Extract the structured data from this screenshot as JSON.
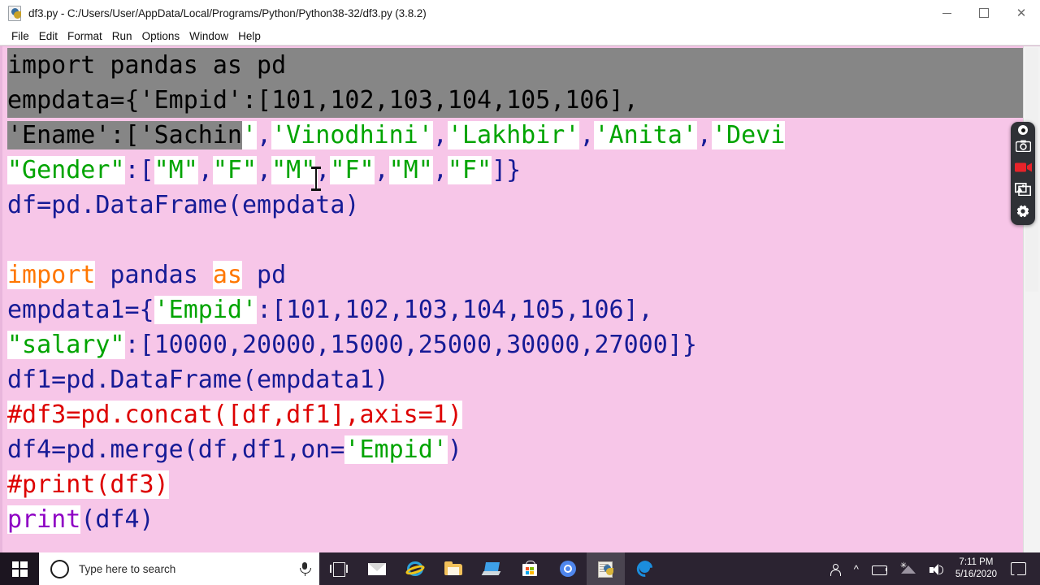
{
  "window": {
    "title": "df3.py - C:/Users/User/AppData/Local/Programs/Python/Python38-32/df3.py (3.8.2)",
    "icon": "python-file-icon",
    "minimize_label": "—",
    "maximize_label": "□",
    "close_label": "✕"
  },
  "menubar": {
    "items": [
      {
        "label": "File"
      },
      {
        "label": "Edit"
      },
      {
        "label": "Format"
      },
      {
        "label": "Run"
      },
      {
        "label": "Options"
      },
      {
        "label": "Window"
      },
      {
        "label": "Help"
      }
    ]
  },
  "editor": {
    "lines": [
      {
        "segments": [
          {
            "text": "import pandas as pd",
            "style": "sel"
          }
        ]
      },
      {
        "segments": [
          {
            "text": "empdata={'Empid':[101,102,103,104,105,106],",
            "style": "sel"
          }
        ]
      },
      {
        "segments": [
          {
            "text": "'Ename':['Sachin",
            "style": "sel"
          },
          {
            "text": "'",
            "style": "str-white"
          },
          {
            "text": ",",
            "style": "code"
          },
          {
            "text": "'Vinodhini'",
            "style": "str-white"
          },
          {
            "text": ",",
            "style": "code"
          },
          {
            "text": "'Lakhbir'",
            "style": "str-white"
          },
          {
            "text": ",",
            "style": "code"
          },
          {
            "text": "'Anita'",
            "style": "str-white"
          },
          {
            "text": ",",
            "style": "code"
          },
          {
            "text": "'Devi",
            "style": "str-white"
          }
        ]
      },
      {
        "segments": [
          {
            "text": "\"Gender\"",
            "style": "str-white"
          },
          {
            "text": ":[",
            "style": "code"
          },
          {
            "text": "\"M\"",
            "style": "str-white"
          },
          {
            "text": ",",
            "style": "code"
          },
          {
            "text": "\"F\"",
            "style": "str-white"
          },
          {
            "text": ",",
            "style": "code"
          },
          {
            "text": "\"M\"",
            "style": "str-white"
          },
          {
            "text": ",",
            "style": "code"
          },
          {
            "text": "\"F\"",
            "style": "str-white"
          },
          {
            "text": ",",
            "style": "code"
          },
          {
            "text": "\"M\"",
            "style": "str-white"
          },
          {
            "text": ",",
            "style": "code"
          },
          {
            "text": "\"F\"",
            "style": "str-white"
          },
          {
            "text": "]}",
            "style": "code"
          }
        ]
      },
      {
        "segments": [
          {
            "text": "df=pd.DataFrame(empdata)",
            "style": "code"
          }
        ]
      },
      {
        "segments": [
          {
            "text": "",
            "style": "code"
          }
        ]
      },
      {
        "segments": [
          {
            "text": "import",
            "style": "kw-white"
          },
          {
            "text": " pandas ",
            "style": "code"
          },
          {
            "text": "as",
            "style": "kw-white"
          },
          {
            "text": " pd",
            "style": "code"
          }
        ]
      },
      {
        "segments": [
          {
            "text": "empdata1={",
            "style": "code"
          },
          {
            "text": "'Empid'",
            "style": "str-white"
          },
          {
            "text": ":[101,102,103,104,105,106],",
            "style": "code"
          }
        ]
      },
      {
        "segments": [
          {
            "text": "\"salary\"",
            "style": "str-white"
          },
          {
            "text": ":[10000,20000,15000,25000,30000,27000]}",
            "style": "code"
          }
        ]
      },
      {
        "segments": [
          {
            "text": "df1=pd.DataFrame(empdata1)",
            "style": "code"
          }
        ]
      },
      {
        "segments": [
          {
            "text": "#df3=pd.concat([df,df1],axis=1)",
            "style": "comment-white"
          }
        ]
      },
      {
        "segments": [
          {
            "text": "df4=pd.merge(df,df1,on=",
            "style": "code"
          },
          {
            "text": "'Empid'",
            "style": "str-white"
          },
          {
            "text": ")",
            "style": "code"
          }
        ]
      },
      {
        "segments": [
          {
            "text": "#print(df3)",
            "style": "comment-white"
          }
        ]
      },
      {
        "segments": [
          {
            "text": "print",
            "style": "builtin"
          },
          {
            "text": "(df4)",
            "style": "code"
          }
        ]
      }
    ],
    "colors": {
      "background": "#f7c6e8",
      "selection": "#868686",
      "string": "#00a400",
      "keyword": "#ff7700",
      "builtin": "#8e00c4",
      "comment": "#dd0000",
      "code": "#161b96"
    },
    "cursor": "i-beam-text-cursor"
  },
  "recorder_toolbar": {
    "buttons": [
      {
        "name": "record-indicator",
        "icon": "record-dot-icon"
      },
      {
        "name": "screenshot",
        "icon": "camera-icon"
      },
      {
        "name": "record-video",
        "icon": "video-camera-icon"
      },
      {
        "name": "gallery",
        "icon": "image-icon"
      },
      {
        "name": "settings",
        "icon": "gear-icon"
      }
    ],
    "accent": "#e8232a"
  },
  "taskbar": {
    "start": {
      "icon": "windows-logo-icon"
    },
    "search": {
      "placeholder": "Type here to search",
      "mic_icon": "microphone-icon",
      "cortana_icon": "cortana-circle-icon"
    },
    "apps": [
      {
        "name": "task-view",
        "icon": "task-view-icon",
        "active": false
      },
      {
        "name": "mail",
        "icon": "mail-icon",
        "active": false
      },
      {
        "name": "internet-explorer",
        "icon": "internet-explorer-icon",
        "active": false
      },
      {
        "name": "file-explorer",
        "icon": "folder-icon",
        "active": false
      },
      {
        "name": "remote-desktop",
        "icon": "remote-desktop-icon",
        "active": false
      },
      {
        "name": "microsoft-store",
        "icon": "store-bag-icon",
        "active": false
      },
      {
        "name": "chrome",
        "icon": "chrome-icon",
        "active": false
      },
      {
        "name": "python-idle",
        "icon": "python-idle-icon",
        "active": true
      },
      {
        "name": "microsoft-edge",
        "icon": "edge-icon",
        "active": false
      }
    ],
    "tray": {
      "people_icon": "people-icon",
      "chevron": "^",
      "battery_icon": "battery-charging-icon",
      "wifi_icon": "wifi-icon",
      "volume_icon": "speaker-icon",
      "time": "7:11 PM",
      "date": "5/16/2020",
      "action_center_icon": "notification-icon"
    }
  }
}
